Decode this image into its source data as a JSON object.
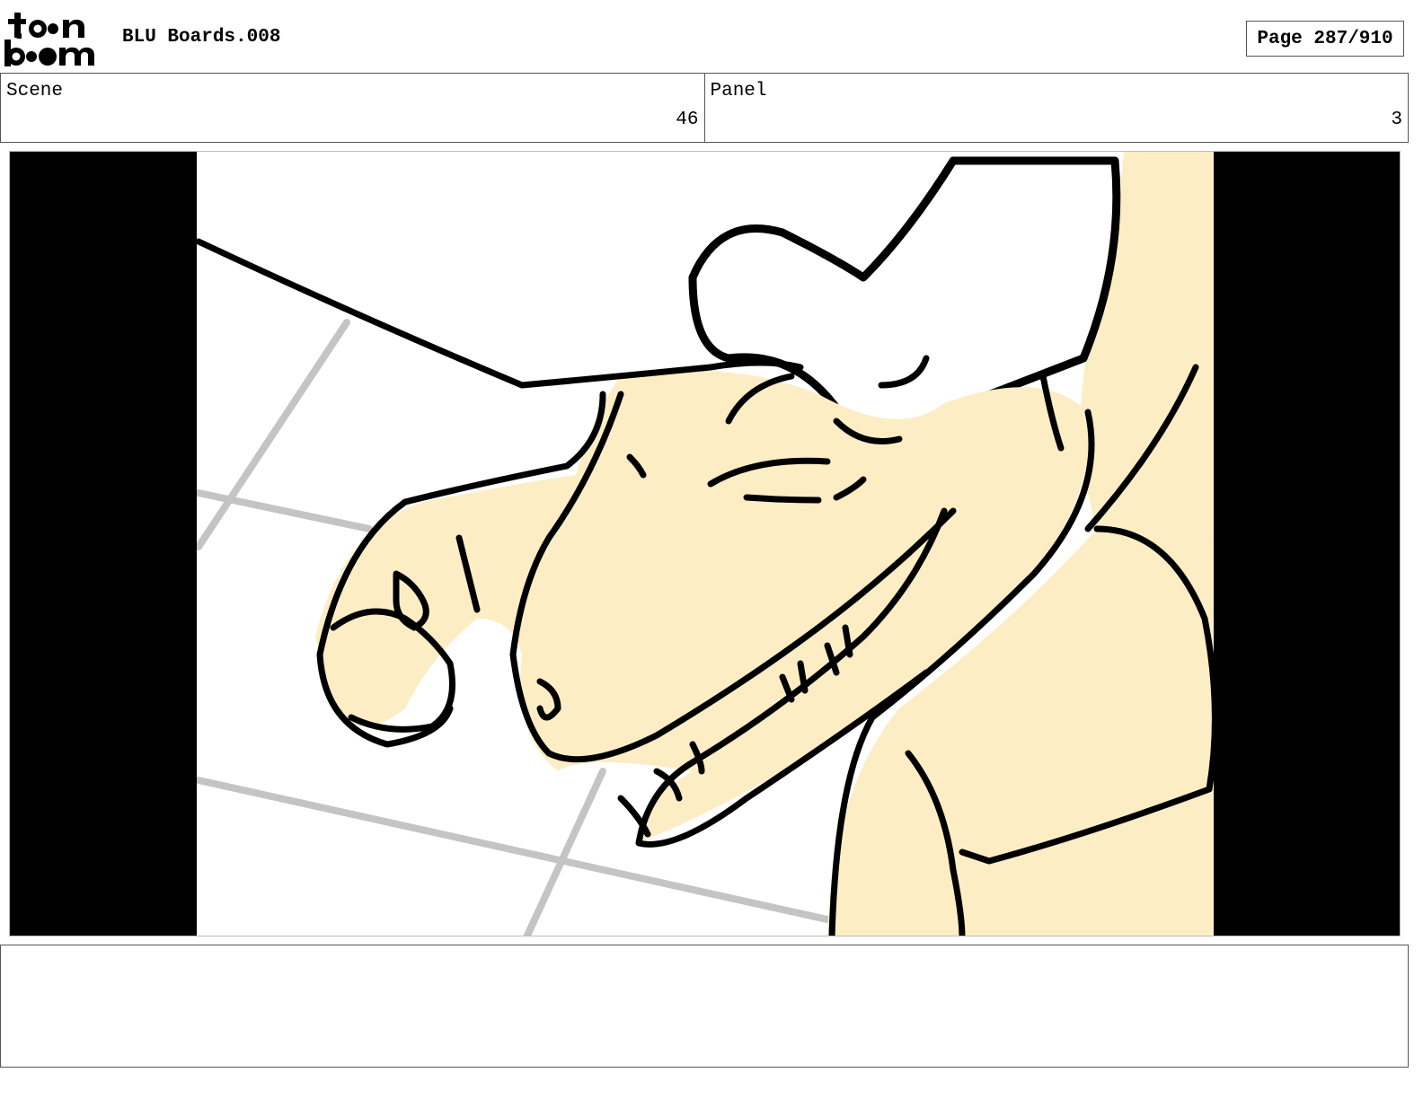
{
  "header": {
    "logo_icon": "toon-boom-logo-icon",
    "title": "BLU Boards.008",
    "page_label": "Page 287/910"
  },
  "info": {
    "scene_label": "Scene",
    "scene_value": "46",
    "panel_label": "Panel",
    "panel_value": "3"
  },
  "panel": {
    "image": "storyboard-sketch",
    "colors": {
      "skin": "#fdedc5",
      "line": "#000000",
      "floor_lines": "#c4c4c4"
    }
  },
  "notes": {
    "text": ""
  }
}
